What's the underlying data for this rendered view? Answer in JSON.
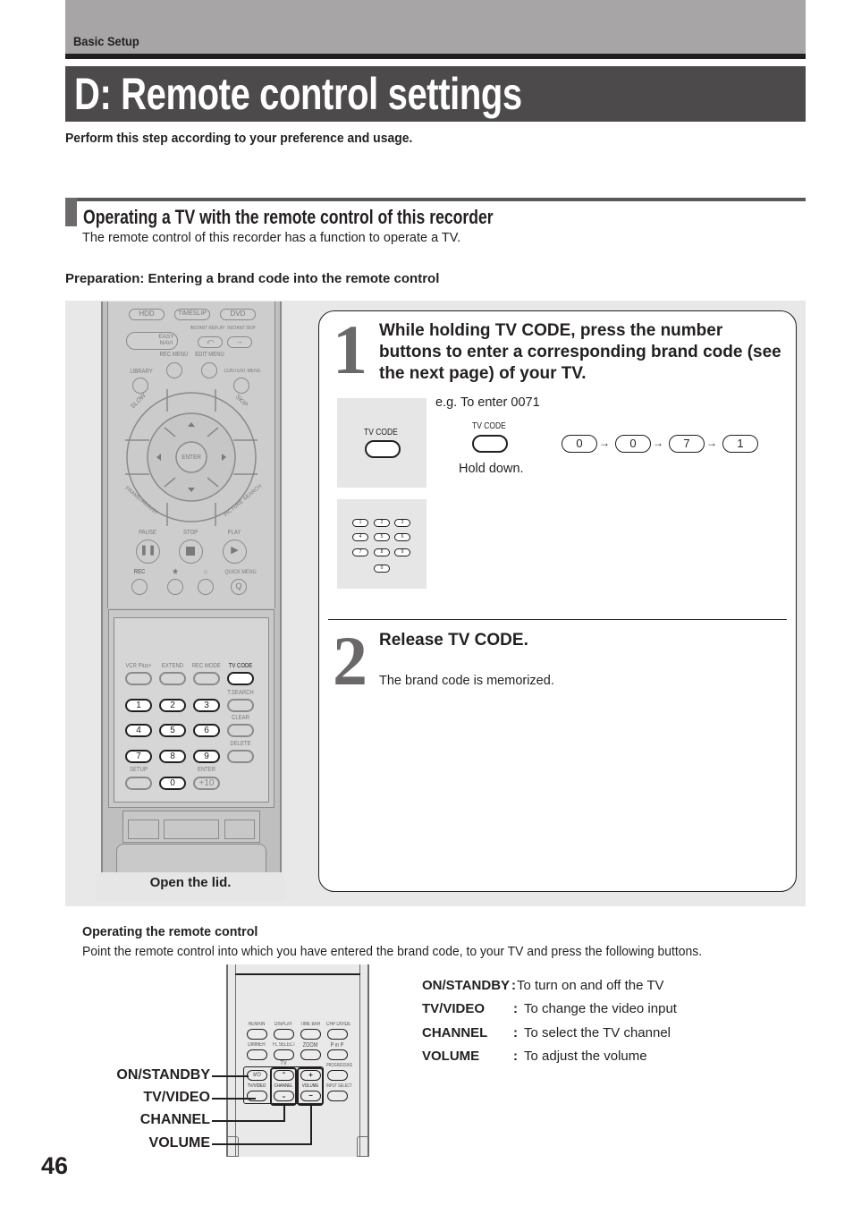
{
  "header": {
    "section_label": "Basic Setup",
    "page_title": "D: Remote control settings",
    "intro": "Perform this step according to your preference and usage."
  },
  "section": {
    "title": "Operating a TV with the remote control of this recorder",
    "description": "The remote control of this recorder has a function to operate a TV.",
    "preparation_title": "Preparation: Entering a brand code into the remote control"
  },
  "remote": {
    "top_buttons": [
      "HDD",
      "TIMESLIP",
      "DVD"
    ],
    "easy_navi": "EASY NAVI",
    "instant_replay": "INSTANT REPLAY",
    "instant_skip": "INSTANT SKIP",
    "rec_menu": "REC MENU",
    "edit_menu": "EDIT MENU",
    "library": "LIBRARY",
    "content_menu": "CONTENT MENU",
    "slow": "SLOW",
    "skip": "SKIP",
    "enter": "ENTER",
    "frame_adjust": "FRAME/ADJUST",
    "picture_search": "PICTURE SEARCH",
    "pause": "PAUSE",
    "stop": "STOP",
    "play": "PLAY",
    "rec": "REC",
    "star": "★",
    "circle": "○",
    "quick_menu": "QUICK MENU",
    "lid_labels": [
      "VCR Plus+",
      "EXTEND",
      "REC MODE",
      "TV CODE"
    ],
    "t_search": "T.SEARCH",
    "clear": "CLEAR",
    "delete": "DELETE",
    "setup": "SETUP",
    "enter_lid": "ENTER",
    "digits": [
      "1",
      "2",
      "3",
      "4",
      "5",
      "6",
      "7",
      "8",
      "9",
      "0"
    ],
    "plus10": "+10",
    "open_lid": "Open the lid."
  },
  "step1": {
    "number": "1",
    "instruction": "While holding TV CODE, press the number buttons to enter a corresponding brand code (see the next page) of your TV.",
    "tv_code_label": "TV CODE",
    "example": "e.g. To enter 0071",
    "hold_down": "Hold down.",
    "sequence": [
      "0",
      "0",
      "7",
      "1"
    ],
    "arrow": "→",
    "keypad": [
      "1",
      "2",
      "3",
      "4",
      "5",
      "6",
      "7",
      "8",
      "9",
      "0"
    ]
  },
  "step2": {
    "number": "2",
    "title": "Release TV CODE.",
    "description": "The brand code is memorized."
  },
  "operating": {
    "title": "Operating the remote control",
    "description": "Point the remote control into which you have entered the brand code, to your TV and press the following buttons.",
    "remote_labels": {
      "row1": [
        "REMAIN",
        "DISPLAY",
        "TIME BAR",
        "CHP DIVIDE"
      ],
      "row2": [
        "DIMMER",
        "FL SELECT",
        "ZOOM",
        "P in P"
      ],
      "tv": "TV",
      "progressive": "PROGRESSIVE",
      "tv_video": "TV/VIDEO",
      "channel": "CHANNEL",
      "volume": "VOLUME",
      "input_select": "INPUT SELECT",
      "power_glyph": "I/⏻",
      "up": "⌃",
      "down": "⌄",
      "plus": "+",
      "minus": "−"
    },
    "callouts": [
      "ON/STANDBY",
      "TV/VIDEO",
      "CHANNEL",
      "VOLUME"
    ],
    "functions": [
      {
        "key": "ON/STANDBY",
        "colon": ":",
        "desc": "To turn on and off the TV"
      },
      {
        "key": "TV/VIDEO",
        "colon": ":",
        "desc": "To change the video input"
      },
      {
        "key": "CHANNEL",
        "colon": ":",
        "desc": "To select the TV channel"
      },
      {
        "key": "VOLUME",
        "colon": ":",
        "desc": "To adjust the volume"
      }
    ]
  },
  "footer": {
    "page_number": "46"
  }
}
